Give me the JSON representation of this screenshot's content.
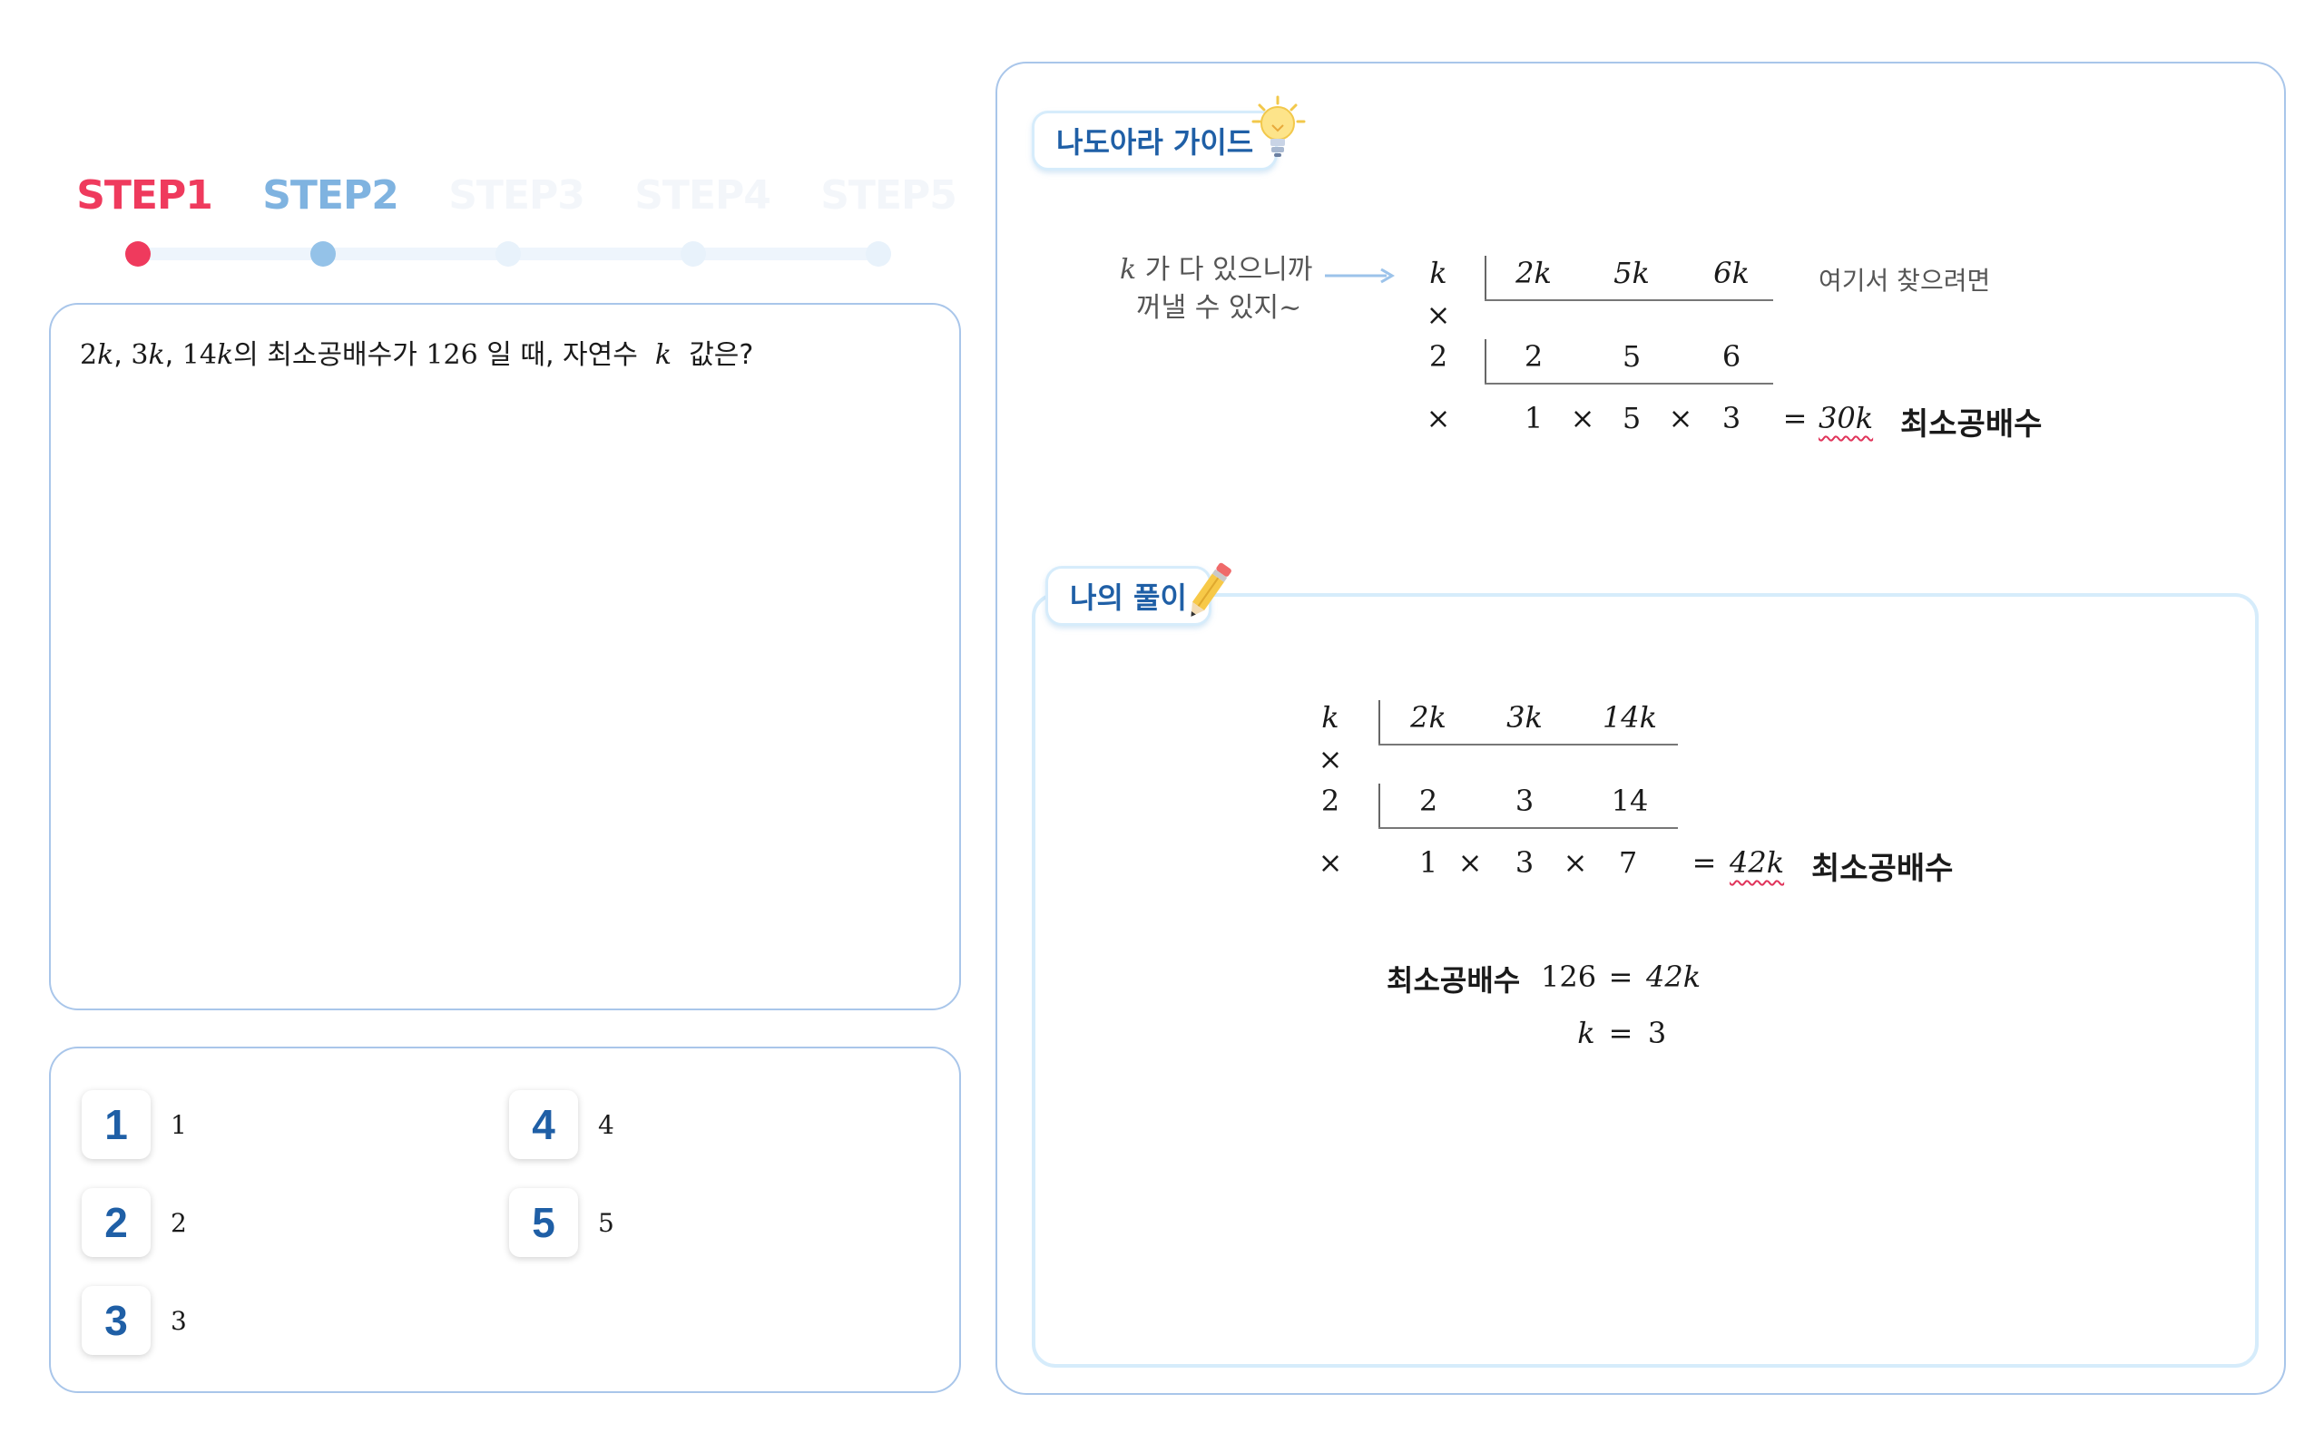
{
  "steps": [
    {
      "label": "STEP1",
      "state": "active"
    },
    {
      "label": "STEP2",
      "state": "done"
    },
    {
      "label": "STEP3",
      "state": "future"
    },
    {
      "label": "STEP4",
      "state": "future"
    },
    {
      "label": "STEP5",
      "state": "future"
    }
  ],
  "question": {
    "t1": "2",
    "k1": "k",
    "comma1": ",",
    "t2": "3",
    "k2": "k",
    "comma2": ",",
    "t3": "14",
    "k3": "k",
    "part1": "의 최소공배수가",
    "num": "126",
    "part2": "일 때, 자연수",
    "var": "k",
    "part3": "값은?"
  },
  "choices": [
    {
      "num": "1",
      "value": "1"
    },
    {
      "num": "2",
      "value": "2"
    },
    {
      "num": "3",
      "value": "3"
    },
    {
      "num": "4",
      "value": "4"
    },
    {
      "num": "5",
      "value": "5"
    }
  ],
  "guide": {
    "title": "나도아라 가이드",
    "note_var": "k",
    "note_line1": "가 다 있으니까",
    "note_line2": "꺼낼 수 있지~",
    "side_note": "여기서 찾으려면",
    "divisor1": "k",
    "row1": [
      "2k",
      "5k",
      "6k"
    ],
    "times": "×",
    "divisor2": "2",
    "row2": [
      "2",
      "5",
      "6"
    ],
    "bottom": [
      "1",
      "×",
      "5",
      "×",
      "3"
    ],
    "eq": "=",
    "result": "30k",
    "result_label": "최소공배수"
  },
  "my_solution": {
    "title": "나의 풀이",
    "divisor1": "k",
    "row1": [
      "2k",
      "3k",
      "14k"
    ],
    "times": "×",
    "divisor2": "2",
    "row2": [
      "2",
      "3",
      "14"
    ],
    "bottom": [
      "1",
      "×",
      "3",
      "×",
      "7"
    ],
    "eq": "=",
    "result": "42k",
    "result_label": "최소공배수",
    "line1_label": "최소공배수",
    "line1_value": "126",
    "line1_eq": "=",
    "line1_rhs": "42k",
    "line2_lhs": "k",
    "line2_eq": "=",
    "line2_rhs": "3"
  },
  "colors": {
    "step_active": "#ef3a5d",
    "step_done": "#7fb3e0",
    "accent_blue": "#1f5fa6",
    "panel_border": "#a9c6ea",
    "wavy_underline": "#e0345a"
  },
  "icons": [
    "lightbulb-icon",
    "pencil-icon",
    "arrow-right-icon"
  ]
}
